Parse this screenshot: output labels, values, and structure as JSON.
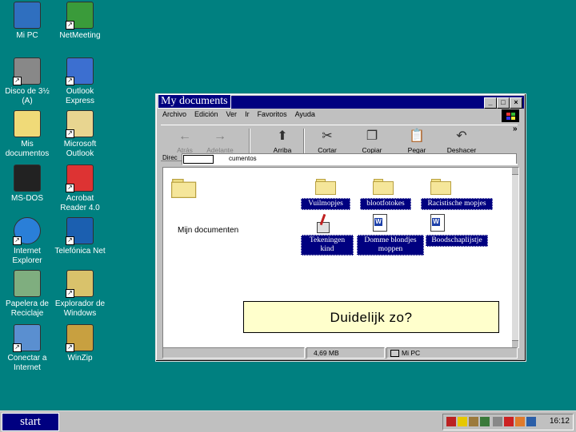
{
  "desktop": {
    "icons": [
      {
        "label": "Mi PC",
        "icon": "computer-icon"
      },
      {
        "label": "NetMeeting",
        "icon": "netmeeting-icon"
      },
      {
        "label": "Disco de 3½ (A)",
        "icon": "floppy-drive-icon"
      },
      {
        "label": "Outlook Express",
        "icon": "outlook-express-icon"
      },
      {
        "label": "Mis documentos",
        "icon": "folder-icon"
      },
      {
        "label": "Microsoft Outlook",
        "icon": "outlook-icon"
      },
      {
        "label": "MS-DOS",
        "icon": "msdos-icon"
      },
      {
        "label": "Acrobat Reader 4.0",
        "icon": "acrobat-icon"
      },
      {
        "label": "Internet Explorer",
        "icon": "internet-explorer-icon"
      },
      {
        "label": "Telefónica Net",
        "icon": "telefonica-net-icon"
      },
      {
        "label": "Papelera de Reciclaje",
        "icon": "recycle-bin-icon"
      },
      {
        "label": "Explorador de Windows",
        "icon": "explorer-icon"
      },
      {
        "label": "Conectar a Internet",
        "icon": "connect-icon"
      },
      {
        "label": "WinZip",
        "icon": "winzip-icon"
      }
    ]
  },
  "window": {
    "title": "My documents",
    "menu": [
      "Archivo",
      "Edición",
      "Ver",
      "Ir",
      "Favoritos",
      "Ayuda"
    ],
    "toolbar": [
      {
        "label": "Atrás",
        "icon": "back-arrow-icon",
        "disabled": true
      },
      {
        "label": "Adelante",
        "icon": "forward-arrow-icon",
        "disabled": true
      },
      {
        "label": "Arriba",
        "icon": "up-folder-icon",
        "disabled": false
      },
      {
        "label": "Cortar",
        "icon": "scissors-icon",
        "disabled": false
      },
      {
        "label": "Copiar",
        "icon": "copy-icon",
        "disabled": false
      },
      {
        "label": "Pegar",
        "icon": "paste-icon",
        "disabled": false
      },
      {
        "label": "Deshacer",
        "icon": "undo-icon",
        "disabled": false
      }
    ],
    "address_label": "Direc",
    "address_value": "cumentos",
    "side_label": "Mijn documenten",
    "items": [
      {
        "label": "Vuilmopjes",
        "type": "folder"
      },
      {
        "label": "blootfotokes",
        "type": "folder"
      },
      {
        "label": "Racistische mopjes",
        "type": "folder"
      },
      {
        "label": "Tekeningen kind",
        "type": "app"
      },
      {
        "label": "Domme blondjes moppen",
        "type": "word-doc"
      },
      {
        "label": "Boodschaplijstje",
        "type": "word-doc"
      }
    ],
    "callout": "Duidelijk zo?",
    "status": {
      "size": "4,69 MB",
      "location": "Mi PC"
    },
    "chevrons": "»"
  },
  "taskbar": {
    "start_label": "start",
    "clock": "16:12"
  }
}
